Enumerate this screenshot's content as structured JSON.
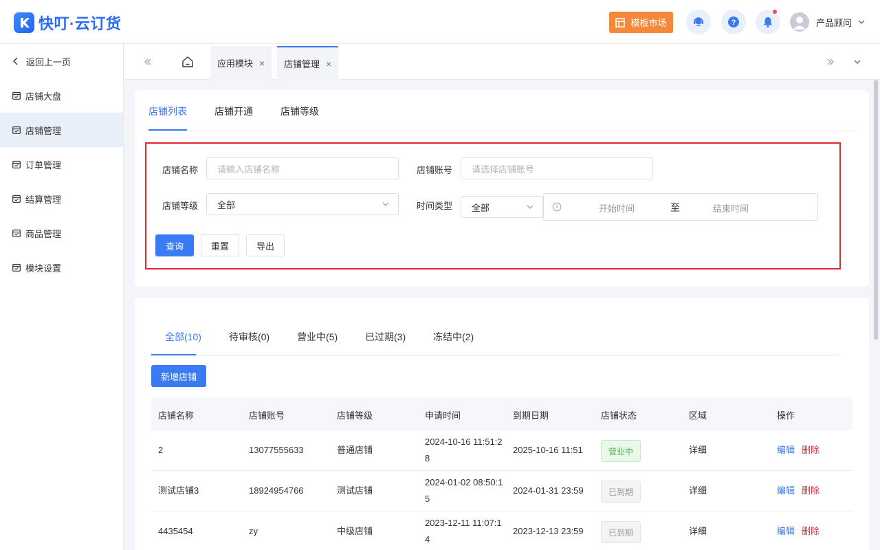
{
  "app": {
    "logo_text": "快叮·云订货"
  },
  "header": {
    "market_label": "模板市场",
    "user_name": "产品顾问"
  },
  "sidebar": {
    "back_label": "返回上一页",
    "items": [
      {
        "label": "店铺大盘"
      },
      {
        "label": "店铺管理"
      },
      {
        "label": "订单管理"
      },
      {
        "label": "结算管理"
      },
      {
        "label": "商品管理"
      },
      {
        "label": "模块设置"
      }
    ],
    "active_index": 1
  },
  "page_tabs": [
    {
      "label": "应用模块"
    },
    {
      "label": "店铺管理"
    }
  ],
  "sub_tabs": [
    {
      "label": "店铺列表"
    },
    {
      "label": "店铺开通"
    },
    {
      "label": "店铺等级"
    }
  ],
  "filter": {
    "store_name_label": "店铺名称",
    "store_name_placeholder": "请输入店铺名称",
    "store_account_label": "店铺账号",
    "store_account_placeholder": "请选择店铺账号",
    "store_level_label": "店铺等级",
    "store_level_value": "全部",
    "time_type_label": "时间类型",
    "time_type_value": "全部",
    "start_placeholder": "开始时间",
    "range_sep": "至",
    "end_placeholder": "结束时间",
    "query_label": "查询",
    "reset_label": "重置",
    "export_label": "导出"
  },
  "status_tabs": [
    {
      "label": "全部(10)"
    },
    {
      "label": "待审核(0)"
    },
    {
      "label": "营业中(5)"
    },
    {
      "label": "已过期(3)"
    },
    {
      "label": "冻结中(2)"
    }
  ],
  "add_button_label": "新增店铺",
  "table": {
    "columns": [
      "店铺名称",
      "店铺账号",
      "店铺等级",
      "申请时间",
      "到期日期",
      "店铺状态",
      "区域",
      "操作"
    ],
    "rows": [
      {
        "name": "2",
        "account": "13077555633",
        "level": "普通店铺",
        "apply_line1": "2024-10-16 11:51:2",
        "apply_line2": "8",
        "expire": "2025-10-16 11:51",
        "status": "营业中",
        "region": "详细",
        "edit": "编辑",
        "delete": "删除"
      },
      {
        "name": "测试店铺3",
        "account": "18924954766",
        "level": "测试店铺",
        "apply_line1": "2024-01-02 08:50:1",
        "apply_line2": "5",
        "expire": "2024-01-31 23:59",
        "status": "已到期",
        "region": "详细",
        "edit": "编辑",
        "delete": "删除"
      },
      {
        "name": "4435454",
        "account": "zy",
        "level": "中级店铺",
        "apply_line1": "2023-12-11 11:07:1",
        "apply_line2": "4",
        "expire": "2023-12-13 23:59",
        "status": "已到期",
        "region": "详细",
        "edit": "编辑",
        "delete": "删除"
      }
    ]
  },
  "colors": {
    "primary": "#3a7bf4",
    "market": "#f5883a",
    "highlight_border": "#e5262f",
    "danger": "#f5222d",
    "success": "#4caf50"
  }
}
